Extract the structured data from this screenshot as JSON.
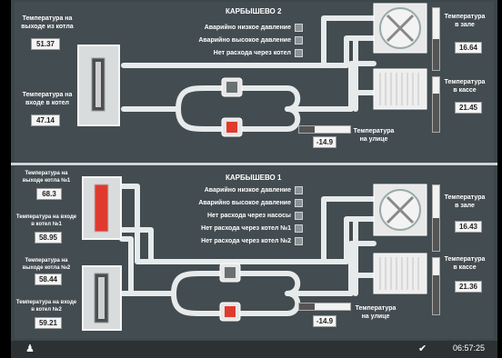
{
  "top": {
    "title": "КАРБЫШЕВО 2",
    "boiler_out": {
      "label": "Температура на выходе из котла",
      "value": "51.37"
    },
    "boiler_in": {
      "label": "Температура на входе в котел",
      "value": "47.14"
    },
    "alarms": [
      "Аварийно низкое давление",
      "Аварийно высокое давление",
      "Нет расхода через котел"
    ],
    "hall": {
      "label": "Температура в зале",
      "value": "16.64",
      "level": 0.5
    },
    "kassa": {
      "label": "Температура в кассе",
      "value": "21.45",
      "level": 0.7
    },
    "outside": {
      "label": "Температура на улице",
      "value": "-14.9",
      "level": 0.3
    }
  },
  "bottom": {
    "title": "КАРБЫШЕВО 1",
    "boiler1_out": {
      "label": "Температура на выходе котла №1",
      "value": "68.3"
    },
    "boiler1_in": {
      "label": "Температура на входе в котел №1",
      "value": "58.95"
    },
    "boiler2_out": {
      "label": "Температура на выходе котла №2",
      "value": "58.44"
    },
    "boiler2_in": {
      "label": "Температура на входе в котел №2",
      "value": "59.21"
    },
    "alarms": [
      "Аварийно низкое давление",
      "Аварийно высокое давление",
      "Нет расхода через насосы",
      "Нет расхода через котел №1",
      "Нет расхода через котел №2"
    ],
    "hall": {
      "label": "Температура в зале",
      "value": "16.43",
      "level": 0.5
    },
    "kassa": {
      "label": "Температура в кассе",
      "value": "21.36",
      "level": 0.7
    },
    "outside": {
      "label": "Температура на улице",
      "value": "-14.9",
      "level": 0.3
    }
  },
  "status": {
    "time": "06:57:25",
    "user_icon": "user-icon",
    "check_icon": "check-icon"
  },
  "colors": {
    "pipe": "#e6eaeb",
    "active": "#e03a2f",
    "panel": "#434c50"
  }
}
